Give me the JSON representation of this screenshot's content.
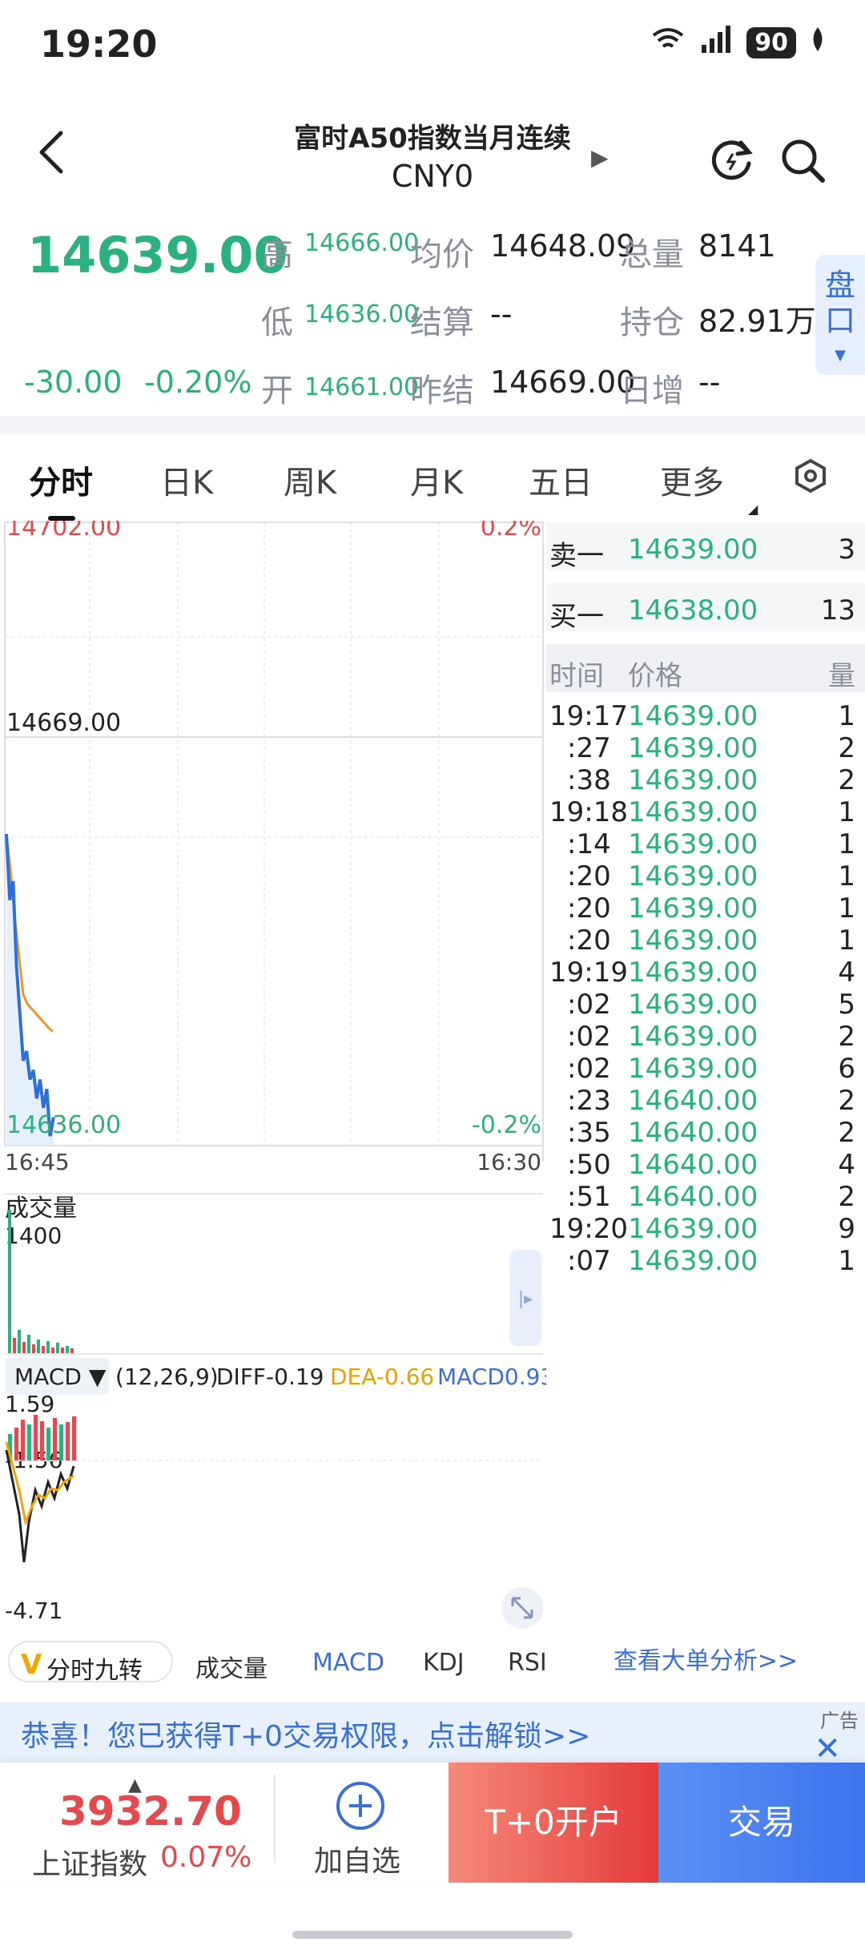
{
  "status": {
    "time": "19:20",
    "network": "6",
    "signal": "5A",
    "battery": "90"
  },
  "header": {
    "title": "富时A50指数当月连续",
    "subtitle": "CNY0"
  },
  "quote": {
    "price": "14639.00",
    "change": "-30.00",
    "change_pct": "-0.20%",
    "high_label": "高",
    "high": "14666.00",
    "low_label": "低",
    "low": "14636.00",
    "open_label": "开",
    "open": "14661.00",
    "avg_label": "均价",
    "avg": "14648.09",
    "settle_label": "结算",
    "settle": "--",
    "prev_settle_label": "昨结",
    "prev_settle": "14669.00",
    "volume_label": "总量",
    "volume": "8141",
    "oi_label": "持仓",
    "oi": "82.91万",
    "daily_inc_label": "日增",
    "daily_inc": "--",
    "pankou_label": "盘口"
  },
  "tabs": [
    "分时",
    "日K",
    "周K",
    "月K",
    "五日",
    "更多"
  ],
  "chart": {
    "top_price": "14702.00",
    "top_pct": "0.2%",
    "mid_price": "14669.00",
    "bottom_price": "14636.00",
    "bottom_pct": "-0.2%",
    "time_start": "16:45",
    "time_end": "16:30",
    "volume_label": "成交量",
    "volume_max": "1400",
    "macd_label": "MACD ▼",
    "macd_params": "(12,26,9)",
    "diff": "DIFF-0.19",
    "dea": "DEA-0.66",
    "macd": "MACD0.93",
    "macd_top": "1.59",
    "macd_mid": "-1.56",
    "macd_bottom": "-4.71"
  },
  "chart_data": {
    "type": "line",
    "series": [
      {
        "name": "price",
        "values": [
          14669,
          14662,
          14664,
          14655,
          14650,
          14645,
          14646,
          14643,
          14644,
          14641,
          14643,
          14640,
          14642,
          14637,
          14639
        ]
      },
      {
        "name": "avg",
        "values": [
          14669,
          14665,
          14660,
          14656,
          14652,
          14651,
          14650.5,
          14650,
          14649.5,
          14649,
          14648.5,
          14648.09
        ]
      }
    ],
    "ylim": [
      14636,
      14702
    ]
  },
  "book": {
    "ask_label": "卖一",
    "ask_price": "14639.00",
    "ask_qty": "3",
    "bid_label": "买一",
    "bid_price": "14638.00",
    "bid_qty": "13",
    "col_time": "时间",
    "col_price": "价格",
    "col_qty": "量",
    "ticks": [
      {
        "t": "19:17",
        "p": "14639.00",
        "q": "1"
      },
      {
        "t": ":27",
        "p": "14639.00",
        "q": "2"
      },
      {
        "t": ":38",
        "p": "14639.00",
        "q": "2"
      },
      {
        "t": "19:18",
        "p": "14639.00",
        "q": "1"
      },
      {
        "t": ":14",
        "p": "14639.00",
        "q": "1"
      },
      {
        "t": ":20",
        "p": "14639.00",
        "q": "1"
      },
      {
        "t": ":20",
        "p": "14639.00",
        "q": "1"
      },
      {
        "t": ":20",
        "p": "14639.00",
        "q": "1"
      },
      {
        "t": "19:19",
        "p": "14639.00",
        "q": "4"
      },
      {
        "t": ":02",
        "p": "14639.00",
        "q": "5"
      },
      {
        "t": ":02",
        "p": "14639.00",
        "q": "2"
      },
      {
        "t": ":02",
        "p": "14639.00",
        "q": "6"
      },
      {
        "t": ":23",
        "p": "14640.00",
        "q": "2"
      },
      {
        "t": ":35",
        "p": "14640.00",
        "q": "2"
      },
      {
        "t": ":50",
        "p": "14640.00",
        "q": "4"
      },
      {
        "t": ":51",
        "p": "14640.00",
        "q": "2"
      },
      {
        "t": "19:20",
        "p": "14639.00",
        "q": "9"
      },
      {
        "t": ":07",
        "p": "14639.00",
        "q": "1"
      }
    ]
  },
  "indicators": {
    "nine_turn": "分时九转",
    "volume": "成交量",
    "macd": "MACD",
    "kdj": "KDJ",
    "rsi": "RSI",
    "big_order": "查看大单分析>>"
  },
  "promo": {
    "text": "恭喜！您已获得T+0交易权限，点击解锁>>",
    "ad": "广告",
    "close": "✕"
  },
  "bottom": {
    "index_value": "3932.70",
    "index_name": "上证指数",
    "index_pct": "0.07%",
    "add_label": "加自选",
    "t0_label": "T+0开户",
    "trade_label": "交易"
  }
}
